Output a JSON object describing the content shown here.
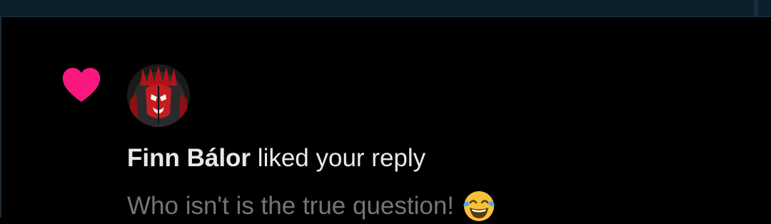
{
  "notification": {
    "type_icon": "heart-icon",
    "like_color": "#f91880",
    "user_name": "Finn Bálor",
    "action_text": " liked your reply",
    "reply_text": "Who isn't is the true question!",
    "reply_emoji": "face-with-tears-of-joy-emoji"
  },
  "colors": {
    "background": "#000000",
    "text_primary": "#e7e9ea",
    "text_secondary": "#71767b",
    "top_bar": "#0d1f2b"
  }
}
